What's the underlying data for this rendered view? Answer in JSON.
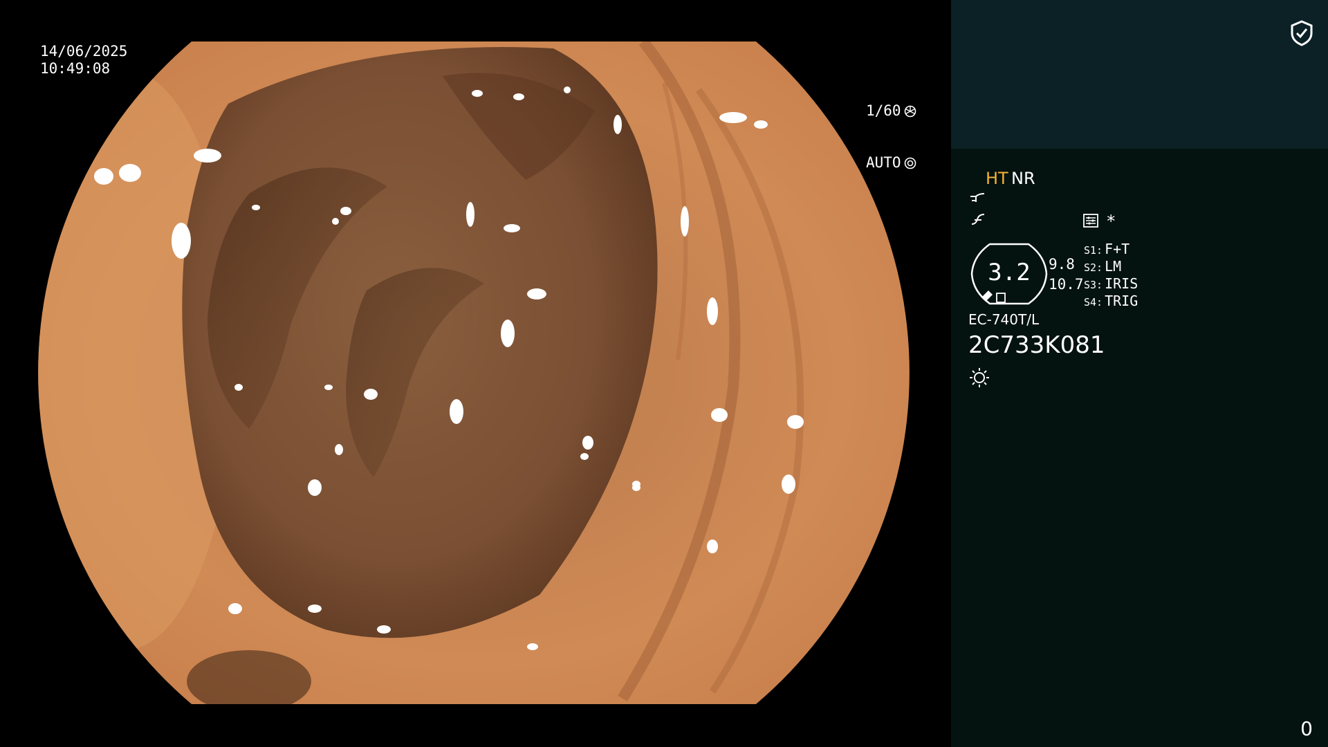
{
  "overlay": {
    "date": "14/06/2025",
    "time": "10:49:08",
    "shutter": "1/60",
    "iris": "AUTO"
  },
  "panel": {
    "mode_ht": "HT",
    "mode_nr": "NR",
    "asterisk": "*",
    "gauge_value": "3.2",
    "gauge_right_1": "9.8",
    "gauge_right_2": "10.7",
    "switches": [
      {
        "key": "S1:",
        "value": "F+T"
      },
      {
        "key": "S2:",
        "value": "LM"
      },
      {
        "key": "S3:",
        "value": "IRIS"
      },
      {
        "key": "S4:",
        "value": "TRIG"
      }
    ],
    "scope_model": "EC-740T/L",
    "scope_serial": "2C733K081",
    "counter": "0"
  },
  "colors": {
    "panel_bg": "#041210",
    "panel_top_bg": "#0b2125",
    "ht_accent": "#f6b431",
    "mucosa": "#c8804a"
  },
  "icons": [
    "shield-check-icon",
    "shutter-icon",
    "iris-icon",
    "enhance-curve-icon",
    "structure-icon",
    "settings-icon",
    "light-sun-icon"
  ]
}
